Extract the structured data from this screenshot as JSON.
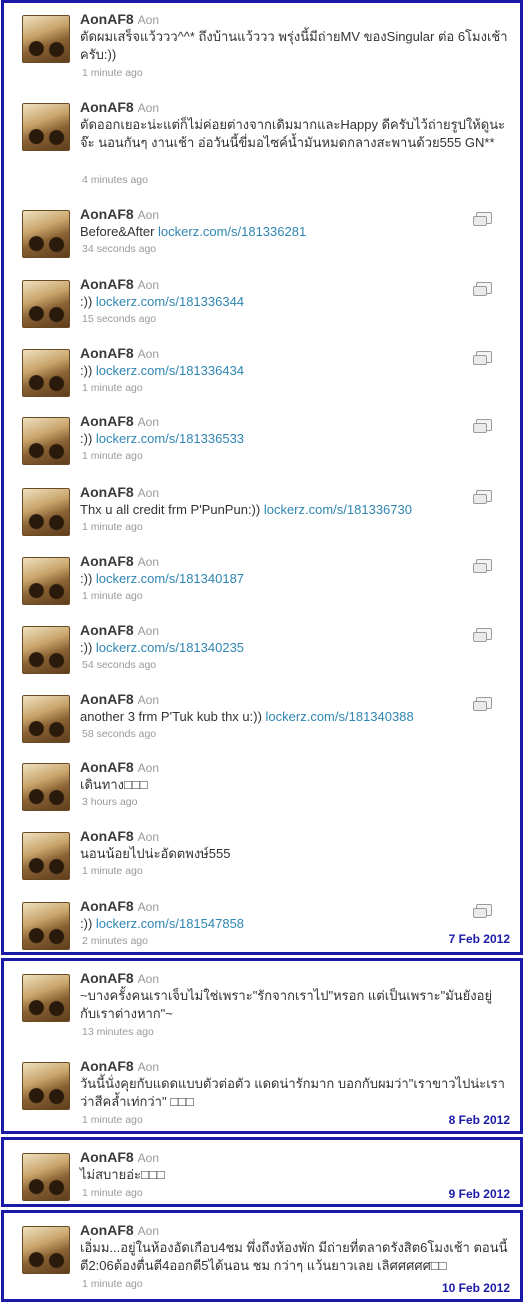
{
  "panels": [
    {
      "date": "7 Feb 2012",
      "tweets": [
        {
          "user": "AonAF8",
          "name": "Aon",
          "text": "ตัดผมเสร็จแว้ววว^^* ถึงบ้านแว้ววว พรุ่งนี้มีถ่ายMV ของSingular ต่อ 6โมงเช้าครับ:))",
          "link": "",
          "time": "1 minute ago",
          "media": false
        },
        {
          "user": "AonAF8",
          "name": "Aon",
          "text": "ตัดออกเยอะน่ะแต่ก็ไม่ค่อยต่างจากเดิมมากและHappy ดีครับไว้ถ่ายรูปให้ดูนะจ๊ะ นอนกันๆ งานเช้า อ่อวันนี้ขี่มอไซค์น้ำมันหมดกลางสะพานด้วย555 GN**",
          "link": "",
          "time": "4 minutes ago",
          "media": false
        },
        {
          "user": "AonAF8",
          "name": "Aon",
          "text": "Before&After ",
          "link": "lockerz.com/s/181336281",
          "time": "34 seconds ago",
          "media": true
        },
        {
          "user": "AonAF8",
          "name": "Aon",
          "text": ":)) ",
          "link": "lockerz.com/s/181336344",
          "time": "15 seconds ago",
          "media": true
        },
        {
          "user": "AonAF8",
          "name": "Aon",
          "text": ":)) ",
          "link": "lockerz.com/s/181336434",
          "time": "1 minute ago",
          "media": true
        },
        {
          "user": "AonAF8",
          "name": "Aon",
          "text": ":)) ",
          "link": "lockerz.com/s/181336533",
          "time": "1 minute ago",
          "media": true
        },
        {
          "user": "AonAF8",
          "name": "Aon",
          "text": "Thx u all credit frm P'PunPun:)) ",
          "link": "lockerz.com/s/181336730",
          "time": "1 minute ago",
          "media": true
        },
        {
          "user": "AonAF8",
          "name": "Aon",
          "text": ":)) ",
          "link": "lockerz.com/s/181340187",
          "time": "1 minute ago",
          "media": true
        },
        {
          "user": "AonAF8",
          "name": "Aon",
          "text": ":)) ",
          "link": "lockerz.com/s/181340235",
          "time": "54 seconds ago",
          "media": true
        },
        {
          "user": "AonAF8",
          "name": "Aon",
          "text": "another 3 frm P'Tuk kub thx u:)) ",
          "link": "lockerz.com/s/181340388",
          "time": "58 seconds ago",
          "media": true
        },
        {
          "user": "AonAF8",
          "name": "Aon",
          "text": "เดินทาง□□□",
          "link": "",
          "time": "3 hours ago",
          "media": false
        },
        {
          "user": "AonAF8",
          "name": "Aon",
          "text": "นอนน้อยไปน่ะอัดตพงษ์555",
          "link": "",
          "time": "1 minute ago",
          "media": false
        },
        {
          "user": "AonAF8",
          "name": "Aon",
          "text": ":)) ",
          "link": "lockerz.com/s/181547858",
          "time": "2 minutes ago",
          "media": true
        }
      ]
    },
    {
      "date": "8 Feb 2012",
      "tweets": [
        {
          "user": "AonAF8",
          "name": "Aon",
          "text": "~บางครั้งคนเราเจ็บไม่ใช่เพราะ\"รักจากเราไป\"หรอก แต่เป็นเพราะ\"มันยังอยู่กับเราต่างหาก\"~",
          "link": "",
          "time": "13 minutes ago",
          "media": false
        },
        {
          "user": "AonAF8",
          "name": "Aon",
          "text": "วันนี้นั่งคุยกับแดดแบบตัวต่อตัว แดดน่ารักมาก บอกกับผมว่า\"เราขาวไปน่ะเราว่าสีคล้ำเท่กว่า\" □□□",
          "link": "",
          "time": "1 minute ago",
          "media": false
        }
      ]
    },
    {
      "date": "9 Feb 2012",
      "tweets": [
        {
          "user": "AonAF8",
          "name": "Aon",
          "text": "ไม่สบายอ่ะ□□□",
          "link": "",
          "time": "1 minute ago",
          "media": false
        }
      ]
    },
    {
      "date": "10 Feb 2012",
      "tweets": [
        {
          "user": "AonAF8",
          "name": "Aon",
          "text": "เอิ่มม...อยู่ในห้องอัดเกือบ4ชม พึ่งถึงห้องพัก มีถ่ายที่ตลาดรังสิต6โมงเช้า ตอนนี้ตี2:06ต้องตื่นตี4ออกตี5ได้นอน ชม กว่าๆ แว้นยาวเลย เลิศศศศศ□□",
          "link": "",
          "time": "1 minute ago",
          "media": false
        }
      ]
    }
  ]
}
